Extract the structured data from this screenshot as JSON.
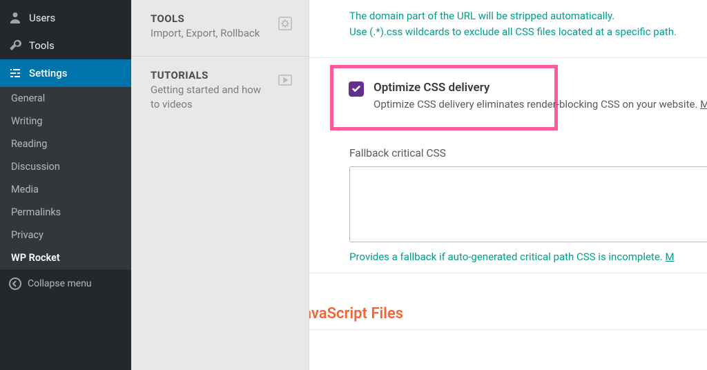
{
  "wp_sidebar": {
    "users": "Users",
    "tools": "Tools",
    "settings": "Settings",
    "submenu": [
      {
        "label": "General"
      },
      {
        "label": "Writing"
      },
      {
        "label": "Reading"
      },
      {
        "label": "Discussion"
      },
      {
        "label": "Media"
      },
      {
        "label": "Permalinks"
      },
      {
        "label": "Privacy"
      },
      {
        "label": "WP Rocket"
      }
    ],
    "collapse": "Collapse menu"
  },
  "wr_sidebar": {
    "tools": {
      "title": "TOOLS",
      "sub": "Import, Export, Rollback"
    },
    "tutorials": {
      "title": "TUTORIALS",
      "sub": "Getting started and how to videos"
    }
  },
  "content": {
    "hint1": "The domain part of the URL will be stripped automatically.",
    "hint2": "Use (.*).css wildcards to exclude all CSS files located at a specific path.",
    "optimize": {
      "title": "Optimize CSS delivery",
      "desc": "Optimize CSS delivery eliminates render-blocking CSS on your website",
      "more": "More info"
    },
    "fallback": {
      "label": "Fallback critical CSS",
      "help_pre": "Provides a fallback if auto-generated critical path CSS is incomplete. ",
      "help_link": "M"
    },
    "js_title": "JavaScript Files"
  }
}
